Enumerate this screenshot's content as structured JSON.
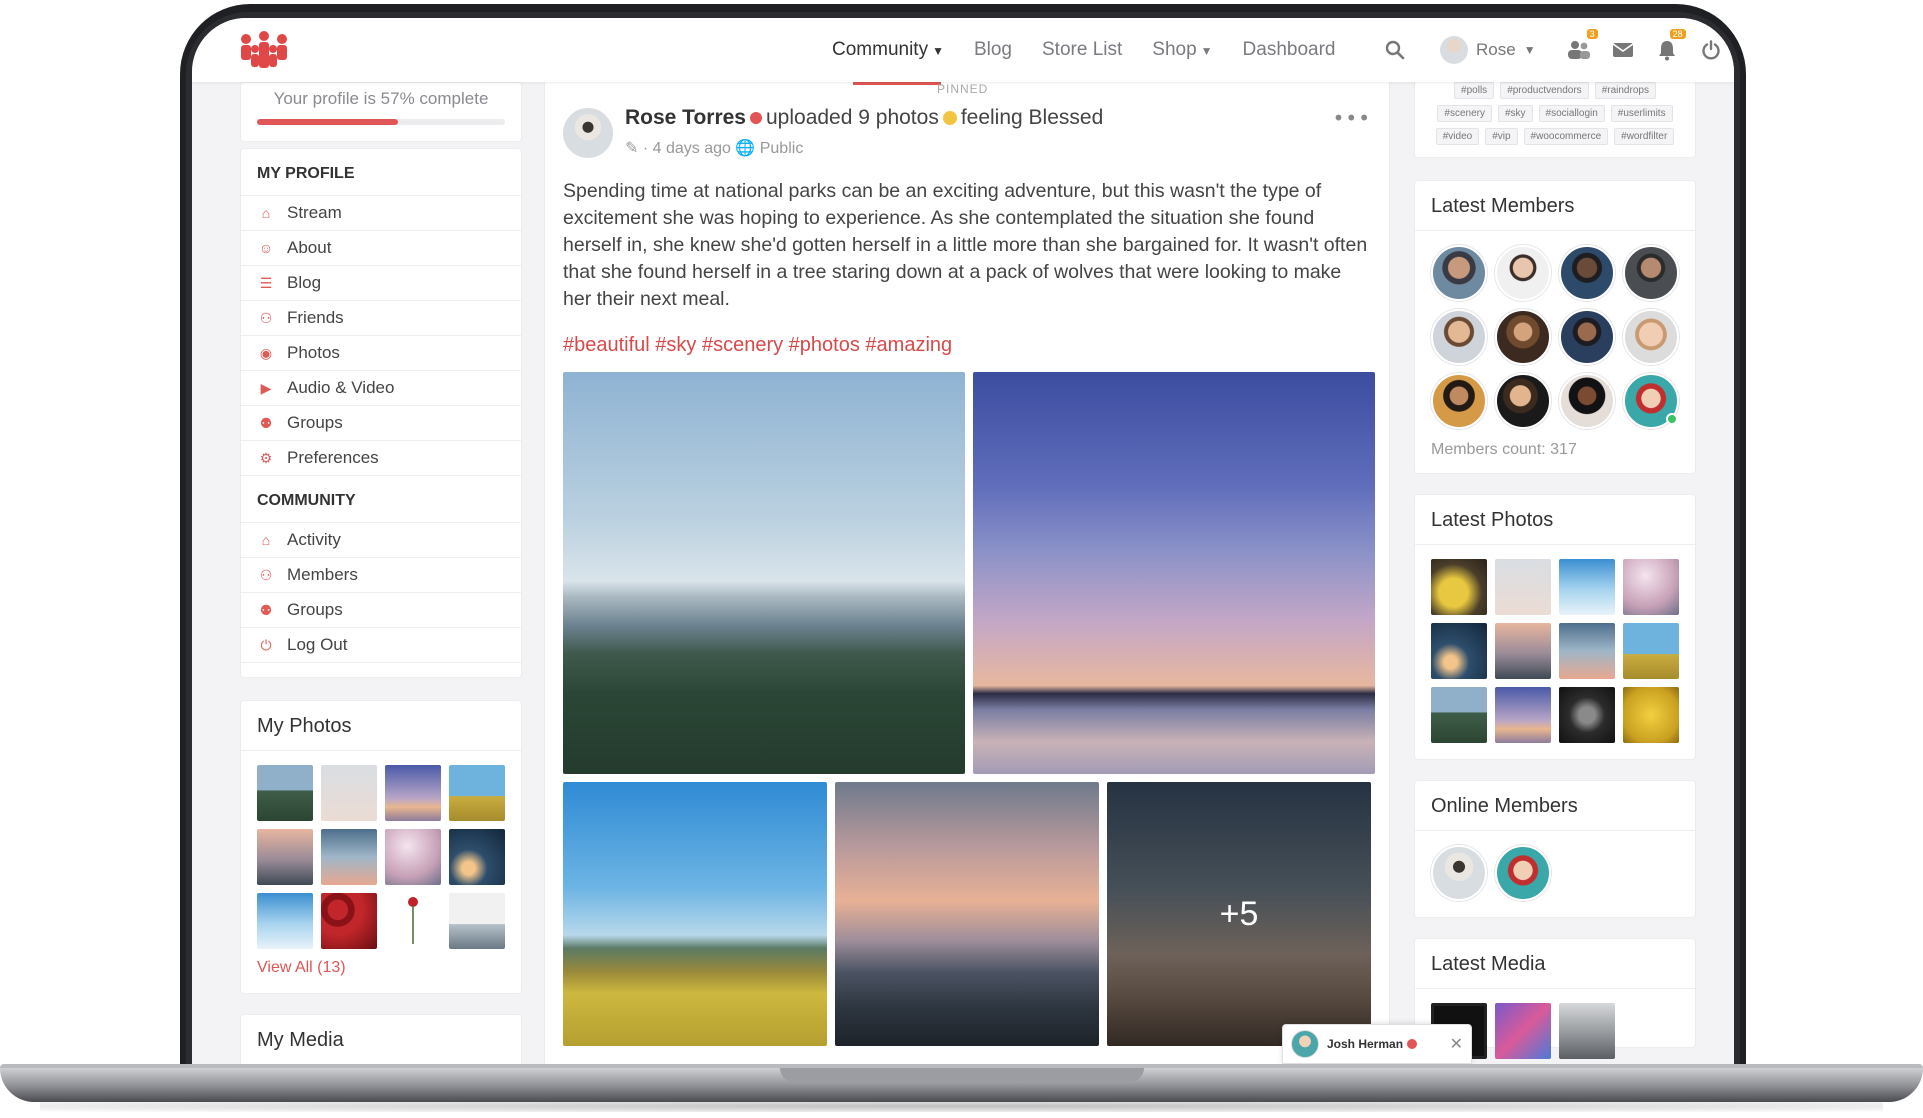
{
  "header": {
    "nav": [
      {
        "label": "Community",
        "dropdown": true,
        "active": true
      },
      {
        "label": "Blog",
        "dropdown": false,
        "active": false
      },
      {
        "label": "Store List",
        "dropdown": false,
        "active": false
      },
      {
        "label": "Shop",
        "dropdown": true,
        "active": false
      },
      {
        "label": "Dashboard",
        "dropdown": false,
        "active": false
      }
    ],
    "user_name": "Rose",
    "friend_requests_badge": "3",
    "notifications_badge": "28"
  },
  "left": {
    "profile_progress_text": "Your profile is 57% complete",
    "profile_progress_percent": 57,
    "my_profile_heading": "MY PROFILE",
    "my_profile_items": [
      "Stream",
      "About",
      "Blog",
      "Friends",
      "Photos",
      "Audio & Video",
      "Groups",
      "Preferences"
    ],
    "community_heading": "COMMUNITY",
    "community_items": [
      "Activity",
      "Members",
      "Groups",
      "Log Out"
    ],
    "my_photos_title": "My Photos",
    "view_all": "View All (13)",
    "my_media_title": "My Media"
  },
  "feed": {
    "pinned_label": "PINNED",
    "author": "Rose Torres",
    "action": "uploaded 9 photos",
    "feeling": "feeling Blessed",
    "time": "4 days ago",
    "visibility": "Public",
    "body": "Spending time at national parks can be an exciting adventure, but this wasn't the type of excitement she was hoping to experience. As she contemplated the situation she found herself in, she knew she'd gotten herself in a little more than she bargained for. It wasn't often that she found herself in a tree staring down at a pack of wolves that were looking to make her their next meal.",
    "hashtags": "#beautiful #sky #scenery #photos #amazing",
    "more_photos_label": "+5"
  },
  "right": {
    "tags": [
      "#polls",
      "#productvendors",
      "#raindrops",
      "#scenery",
      "#sky",
      "#sociallogin",
      "#userlimits",
      "#video",
      "#vip",
      "#woocommerce",
      "#wordfilter"
    ],
    "latest_members_title": "Latest Members",
    "members_count": "Members count: 317",
    "latest_photos_title": "Latest Photos",
    "online_members_title": "Online Members",
    "latest_media_title": "Latest Media"
  },
  "chat": {
    "name": "Josh Herman"
  },
  "colors": {
    "accent": "#e05555",
    "online": "#3cc464"
  }
}
